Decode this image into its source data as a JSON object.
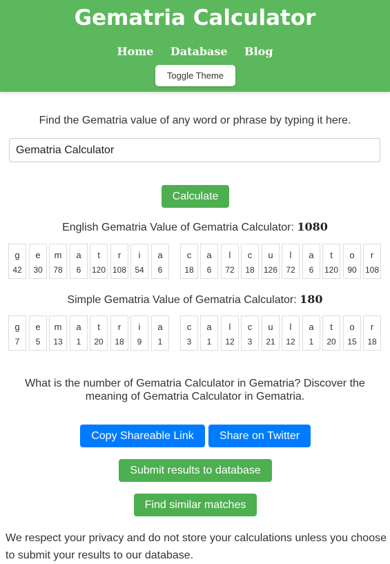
{
  "header": {
    "title": "Gematria Calculator",
    "nav": [
      "Home",
      "Database",
      "Blog"
    ],
    "toggle_label": "Toggle Theme"
  },
  "intro": "Find the Gematria value of any word or phrase by typing it here.",
  "input": {
    "value": "Gematria Calculator"
  },
  "calculate_label": "Calculate",
  "english": {
    "label": "English Gematria Value of Gematria Calculator:",
    "total": "1080",
    "letters": [
      {
        "c": "g",
        "v": "42"
      },
      {
        "c": "e",
        "v": "30"
      },
      {
        "c": "m",
        "v": "78"
      },
      {
        "c": "a",
        "v": "6"
      },
      {
        "c": "t",
        "v": "120"
      },
      {
        "c": "r",
        "v": "108"
      },
      {
        "c": "i",
        "v": "54"
      },
      {
        "c": "a",
        "v": "6"
      },
      {
        "c": "c",
        "v": "18"
      },
      {
        "c": "a",
        "v": "6"
      },
      {
        "c": "l",
        "v": "72"
      },
      {
        "c": "c",
        "v": "18"
      },
      {
        "c": "u",
        "v": "126"
      },
      {
        "c": "l",
        "v": "72"
      },
      {
        "c": "a",
        "v": "6"
      },
      {
        "c": "t",
        "v": "120"
      },
      {
        "c": "o",
        "v": "90"
      },
      {
        "c": "r",
        "v": "108"
      }
    ]
  },
  "simple": {
    "label": "Simple Gematria Value of Gematria Calculator:",
    "total": "180",
    "letters": [
      {
        "c": "g",
        "v": "7"
      },
      {
        "c": "e",
        "v": "5"
      },
      {
        "c": "m",
        "v": "13"
      },
      {
        "c": "a",
        "v": "1"
      },
      {
        "c": "t",
        "v": "20"
      },
      {
        "c": "r",
        "v": "18"
      },
      {
        "c": "i",
        "v": "9"
      },
      {
        "c": "a",
        "v": "1"
      },
      {
        "c": "c",
        "v": "3"
      },
      {
        "c": "a",
        "v": "1"
      },
      {
        "c": "l",
        "v": "12"
      },
      {
        "c": "c",
        "v": "3"
      },
      {
        "c": "u",
        "v": "21"
      },
      {
        "c": "l",
        "v": "12"
      },
      {
        "c": "a",
        "v": "1"
      },
      {
        "c": "t",
        "v": "20"
      },
      {
        "c": "o",
        "v": "15"
      },
      {
        "c": "r",
        "v": "18"
      }
    ]
  },
  "question": "What is the number of Gematria Calculator in Gematria? Discover the meaning of Gematria Calculator in Gematria.",
  "buttons": {
    "copy": "Copy Shareable Link",
    "twitter": "Share on Twitter",
    "submit": "Submit results to database",
    "similar": "Find similar matches"
  },
  "privacy": "We respect your privacy and do not store your calculations unless you choose to submit your results to our database.",
  "colors": {
    "header": "#5cb85c",
    "green_button": "#4caf50",
    "blue_button": "#007bff"
  }
}
